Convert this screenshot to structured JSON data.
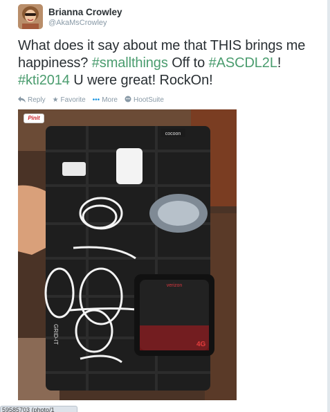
{
  "user": {
    "name": "Brianna Crowley",
    "handle": "@AkaMsCrowley"
  },
  "tweet": {
    "segments": [
      {
        "text": "What does it say about me that THIS brings me happiness? ",
        "type": "text"
      },
      {
        "text": "#smallthings",
        "type": "hashtag"
      },
      {
        "text": " Off to ",
        "type": "text"
      },
      {
        "text": "#ASCDL2L",
        "type": "hashtag"
      },
      {
        "text": "! ",
        "type": "text"
      },
      {
        "text": "#kti2014",
        "type": "hashtag"
      },
      {
        "text": " U were great! RockOn!",
        "type": "text"
      }
    ]
  },
  "actions": {
    "reply": "Reply",
    "favorite": "Favorite",
    "more": "More",
    "hootsuite": "HootSuite"
  },
  "photo": {
    "pin_label": "Pinit",
    "brand_top": "cocoon",
    "brand_side": "GRID-IT",
    "device_brand": "verizon",
    "device_label": "4G"
  },
  "status_tab": "59585703 (photo/1",
  "colors": {
    "hashtag": "#4a9c6e",
    "text": "#292f33",
    "muted": "#8899a6"
  },
  "icons": {
    "reply": "reply-arrow-icon",
    "favorite": "star-icon",
    "more": "dots-icon",
    "hootsuite": "hootsuite-icon"
  }
}
